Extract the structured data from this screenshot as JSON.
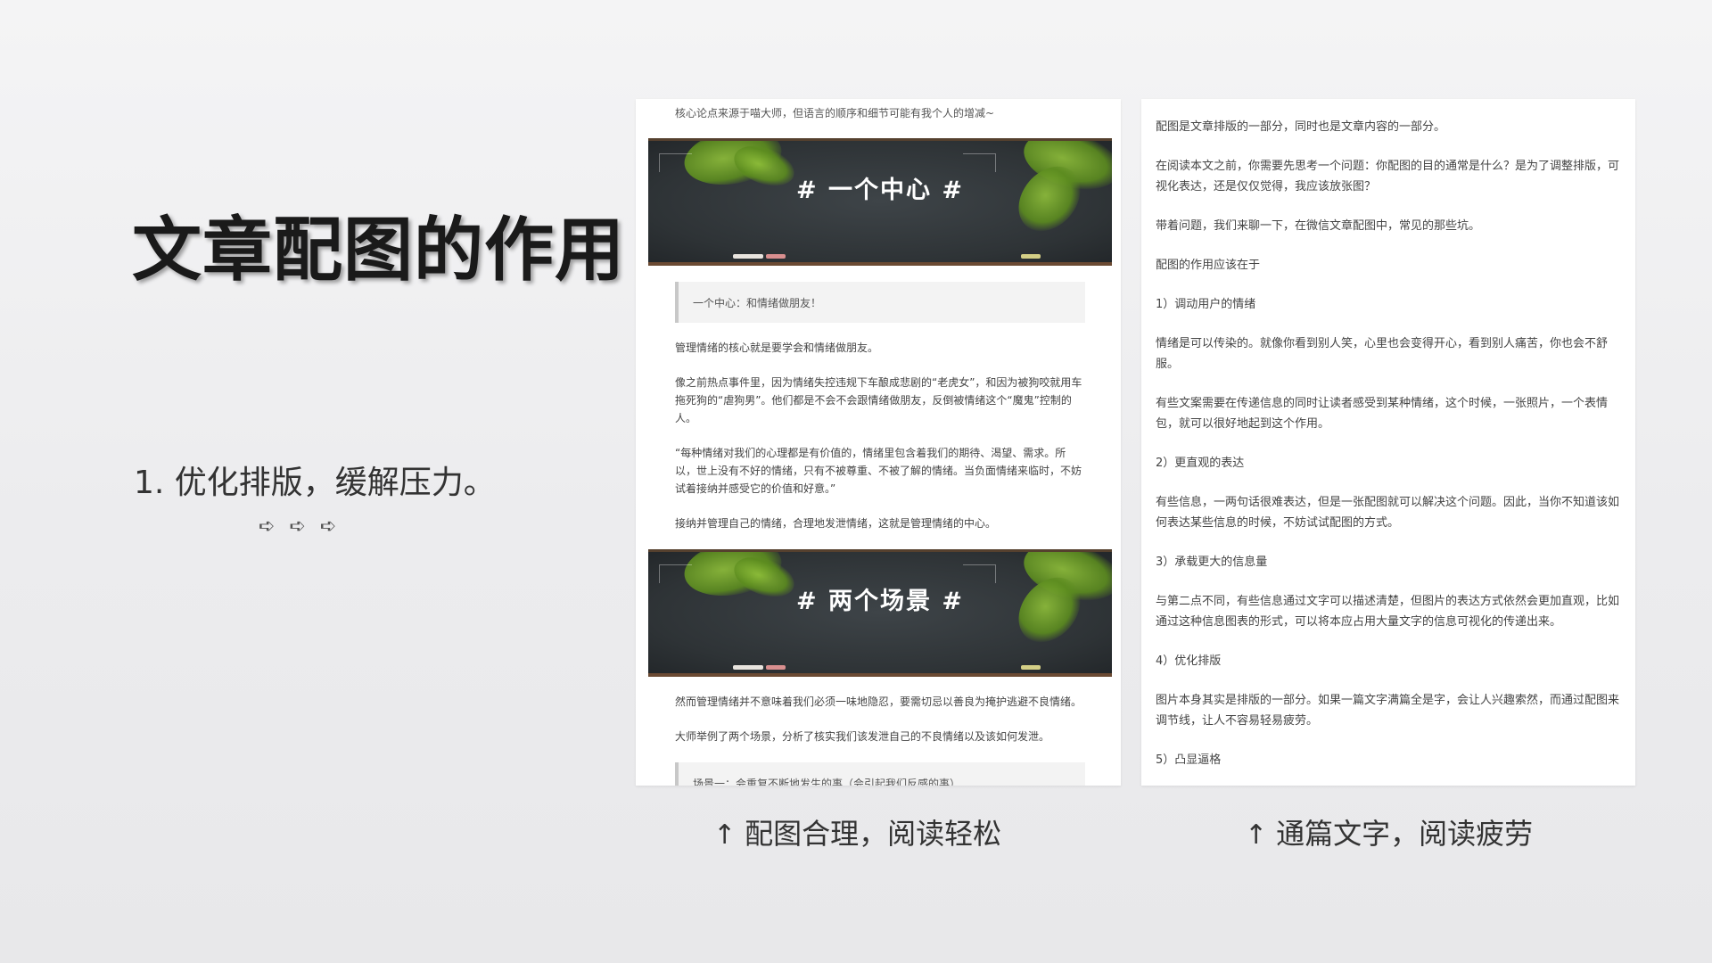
{
  "slide": {
    "title": "文章配图的作用",
    "point": "1. 优化排版，缓解压力。",
    "arrows": [
      "➪",
      "➪",
      "➪"
    ]
  },
  "left_article": {
    "note": "核心论点来源于喵大师，但语言的顺序和细节可能有我个人的增减~",
    "board1_heading": "# 一个中心 #",
    "quote1": "一个中心：和情绪做朋友！",
    "paragraphs1": [
      "管理情绪的核心就是要学会和情绪做朋友。",
      "像之前热点事件里，因为情绪失控违规下车酿成悲剧的“老虎女”，和因为被狗咬就用车拖死狗的“虐狗男”。他们都是不会不会跟情绪做朋友，反倒被情绪这个“魔鬼”控制的人。",
      "“每种情绪对我们的心理都是有价值的，情绪里包含着我们的期待、渴望、需求。所以，世上没有不好的情绪，只有不被尊重、不被了解的情绪。当负面情绪来临时，不妨试着接纳并感受它的价值和好意。”",
      "接纳并管理自己的情绪，合理地发泄情绪，这就是管理情绪的中心。"
    ],
    "board2_heading": "# 两个场景 #",
    "paragraphs2": [
      "然而管理情绪并不意味着我们必须一味地隐忍，要需切忌以善良为掩护逃避不良情绪。",
      "大师举例了两个场景，分析了核实我们该发泄自己的不良情绪以及该如何发泄。"
    ],
    "quote2": "场景一：会重复不断地发生的事（会引起我们反感的事）"
  },
  "right_article": {
    "paragraphs": [
      "配图是文章排版的一部分，同时也是文章内容的一部分。",
      "在阅读本文之前，你需要先思考一个问题：你配图的目的通常是什么？是为了调整排版，可视化表达，还是仅仅觉得，我应该放张图？",
      "带着问题，我们来聊一下，在微信文章配图中，常见的那些坑。",
      "配图的作用应该在于",
      "1）调动用户的情绪",
      "情绪是可以传染的。就像你看到别人笑，心里也会变得开心，看到别人痛苦，你也会不舒服。",
      "有些文案需要在传递信息的同时让读者感受到某种情绪，这个时候，一张照片，一个表情包，就可以很好地起到这个作用。",
      "2）更直观的表达",
      "有些信息，一两句话很难表达，但是一张配图就可以解决这个问题。因此，当你不知道该如何表达某些信息的时候，不妨试试配图的方式。",
      "3）承载更大的信息量",
      "与第二点不同，有些信息通过文字可以描述清楚，但图片的表达方式依然会更加直观，比如通过这种信息图表的形式，可以将本应占用大量文字的信息可视化的传递出来。",
      "4）优化排版",
      "图片本身其实是排版的一部分。如果一篇文字满篇全是字，会让人兴趣索然，而通过配图来调节线，让人不容易轻易疲劳。",
      "5）凸显逼格"
    ]
  },
  "captions": {
    "up_arrow": "↑",
    "left": "配图合理，阅读轻松",
    "right": "通篇文字，阅读疲劳"
  }
}
